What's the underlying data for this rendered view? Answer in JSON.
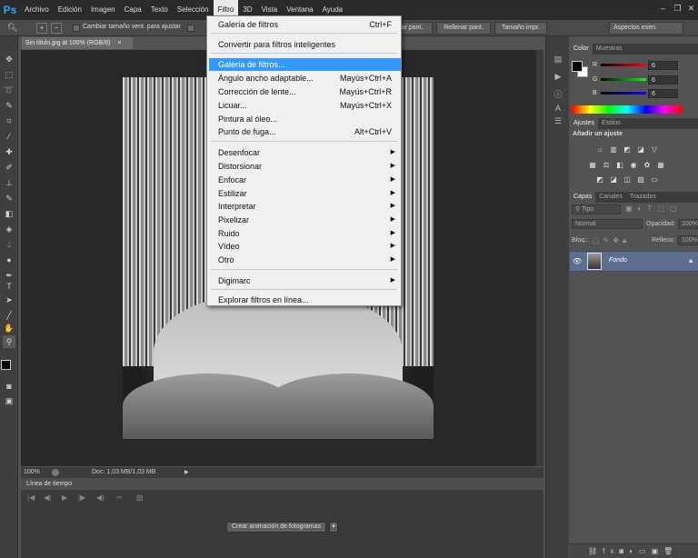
{
  "menubar": {
    "items": [
      "Archivo",
      "Edición",
      "Imagen",
      "Capa",
      "Texto",
      "Selección",
      "Filtro",
      "3D",
      "Vista",
      "Ventana",
      "Ayuda"
    ],
    "active": "Filtro"
  },
  "options": {
    "checkbox_label": "Cambiar tamaño vent. para ajustar",
    "btn_fill": "llenar pant.",
    "btn_fill2": "Rellenar pant.",
    "btn_print": "Tamaño impr.",
    "workspace": "Aspectos esen."
  },
  "document": {
    "tab": "Sin título.jpg al 100% (RGB/8)",
    "zoom": "100%",
    "doc_info": "Doc: 1,03 MB/1,03 MB"
  },
  "timeline": {
    "title": "Línea de tiempo",
    "create_button": "Crear animación de fotogramas"
  },
  "filter_menu": {
    "items": [
      {
        "label": "Galería de filtros",
        "shortcut": "Ctrl+F"
      },
      {
        "label": "Convertir para filtros inteligentes"
      },
      {
        "label": "Galería de filtros...",
        "highlighted": true
      },
      {
        "label": "Ángulo ancho adaptable...",
        "shortcut": "Mayús+Ctrl+A"
      },
      {
        "label": "Corrección de lente...",
        "shortcut": "Mayús+Ctrl+R"
      },
      {
        "label": "Licuar...",
        "shortcut": "Mayús+Ctrl+X"
      },
      {
        "label": "Pintura al óleo..."
      },
      {
        "label": "Punto de fuga...",
        "shortcut": "Alt+Ctrl+V"
      },
      {
        "label": "Desenfocar",
        "submenu": true
      },
      {
        "label": "Distorsionar",
        "submenu": true
      },
      {
        "label": "Enfocar",
        "submenu": true
      },
      {
        "label": "Estilizar",
        "submenu": true
      },
      {
        "label": "Interpretar",
        "submenu": true
      },
      {
        "label": "Pixelizar",
        "submenu": true
      },
      {
        "label": "Ruido",
        "submenu": true
      },
      {
        "label": "Vídeo",
        "submenu": true
      },
      {
        "label": "Otro",
        "submenu": true
      },
      {
        "label": "Digimarc",
        "submenu": true
      },
      {
        "label": "Explorar filtros en línea..."
      }
    ]
  },
  "color_panel": {
    "tabs": [
      "Color",
      "Muestras"
    ],
    "channels": [
      {
        "label": "R",
        "value": "6",
        "color": "#ff0000"
      },
      {
        "label": "G",
        "value": "6",
        "color": "#00ff00"
      },
      {
        "label": "B",
        "value": "6",
        "color": "#0000ff"
      }
    ]
  },
  "adjust_panel": {
    "tabs": [
      "Ajustes",
      "Estilos"
    ],
    "title": "Añadir un ajuste"
  },
  "layers_panel": {
    "tabs": [
      "Capas",
      "Canales",
      "Trazados"
    ],
    "filter_placeholder": "Tipo",
    "blend_mode": "Normal",
    "opacity_label": "Opacidad:",
    "opacity_value": "100%",
    "lock_label": "Bloq.:",
    "fill_label": "Relleno:",
    "fill_value": "100%",
    "layer_name": "Fondo"
  },
  "colors": {
    "accent": "#3399ff",
    "menubar": "#2b2b2b",
    "panel": "#535353",
    "canvas": "#282828",
    "layer_selected": "#5d6f8f"
  }
}
